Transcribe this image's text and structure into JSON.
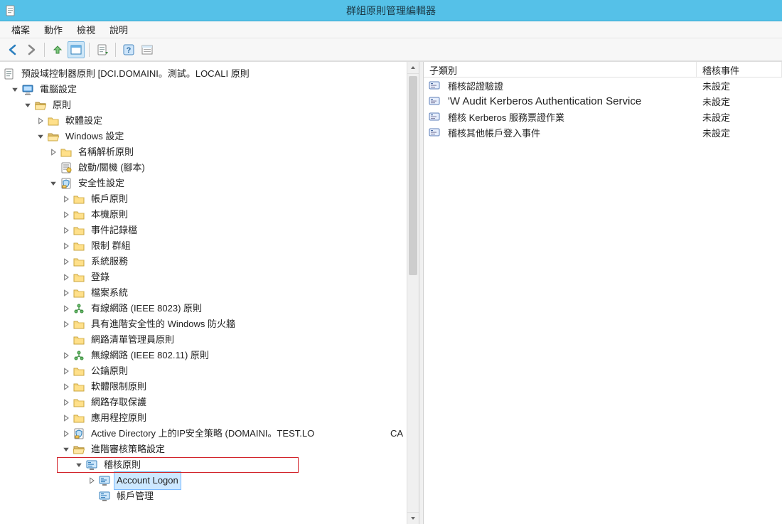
{
  "window": {
    "title": "群組原則管理編輯器"
  },
  "menu": {
    "file": "檔案",
    "action": "動作",
    "view": "檢視",
    "help": "說明"
  },
  "tree": {
    "root": "預設域控制器原則 [DCI.DOMAINI。測試。LOCALI 原則",
    "computer_config": "電腦設定",
    "policies": "原則",
    "software_settings": "軟體設定",
    "windows_settings": "Windows 設定",
    "name_resolution": "名稱解析原則",
    "scripts": "啟動/關機 (腳本)",
    "security_settings": "安全性設定",
    "account_policies": "帳戶原則",
    "local_policies": "本機原則",
    "event_log": "事件記錄檔",
    "restricted_groups": "限制 群組",
    "system_services": "系統服務",
    "registry": "登錄",
    "file_system": "檔案系統",
    "wired_8023": "有線網路 (IEEE 8023) 原則",
    "windows_firewall": "具有進階安全性的 Windows 防火牆",
    "nlm": "網路清單管理員原則",
    "wireless_80211": "無線網路 (IEEE 802.11) 原則",
    "public_key": "公鑰原則",
    "software_restriction": "軟體限制原則",
    "nap": "網路存取保護",
    "app_control": "應用程控原則",
    "ipsec_ad": "Active Directory 上的IP安全策略 (DOMAINI。TEST.LO",
    "ipsec_ad_suffix": "CA",
    "advanced_audit": "進階審核策略設定",
    "audit_policies": "稽核原則",
    "account_logon": "Account Logon",
    "account_management": "帳戶管理"
  },
  "list": {
    "col_subcategory": "子類別",
    "col_audit_events": "稽核事件",
    "rows": [
      {
        "label": "稽核認證驗證",
        "value": "未設定"
      },
      {
        "label": "'W Audit Kerberos Authentication Service",
        "value": "未設定"
      },
      {
        "label": "稽核 Kerberos 服務票證作業",
        "value": "未設定"
      },
      {
        "label": "稽核其他帳戶登入事件",
        "value": "未設定"
      }
    ]
  }
}
